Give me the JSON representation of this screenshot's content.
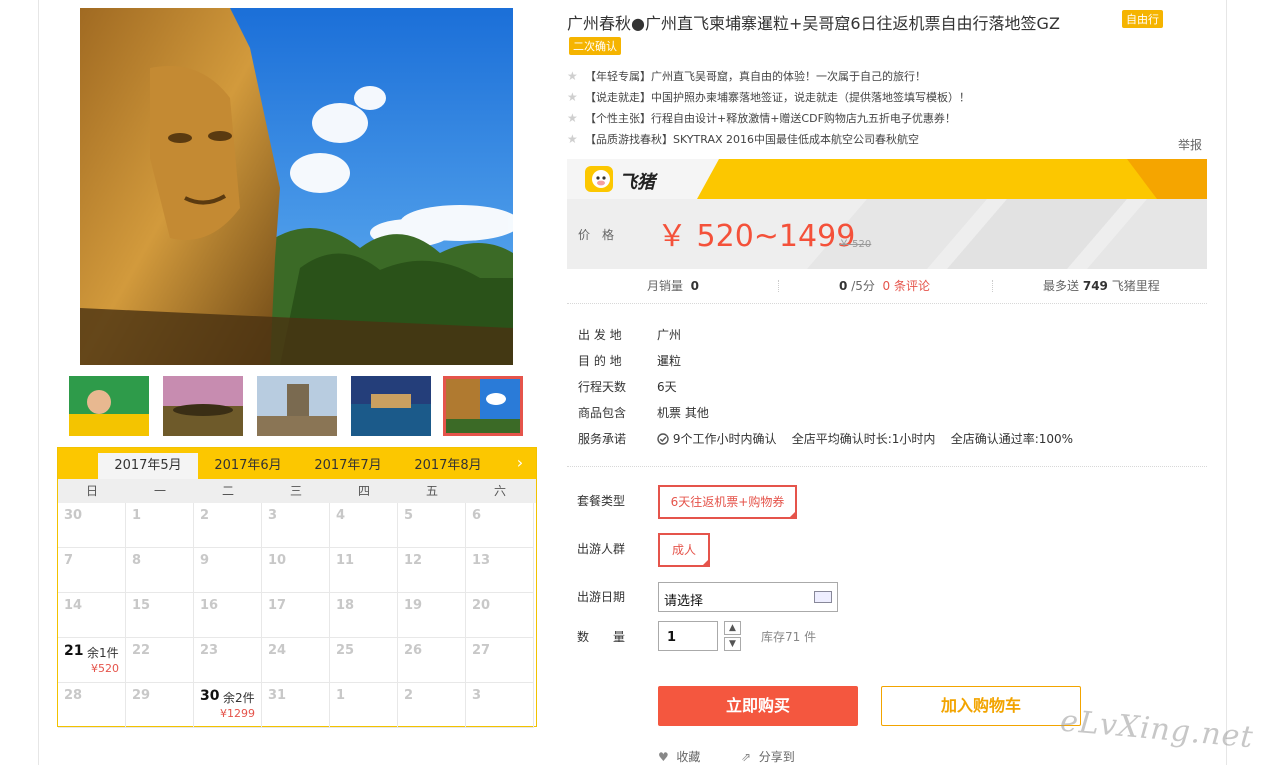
{
  "product": {
    "title": "广州春秋●广州直飞柬埔寨暹粒+吴哥窟6日往返机票自由行落地签GZ",
    "tag_free": "自由行",
    "tag_confirm": "二次确认",
    "features": [
      "【年轻专属】广州直飞吴哥窟，真自由的体验！一次属于自己的旅行！",
      "【说走就走】中国护照办柬埔寨落地签证，说走就走（提供落地签填写模板）！",
      "【个性主张】行程自由设计+释放激情+赠送CDF购物店九五折电子优惠券！",
      "【品质游找春秋】SKYTRAX 2016中国最佳低成本航空公司春秋航空"
    ],
    "report": "举报"
  },
  "brand": {
    "logo_text": "飞猪",
    "accent": "#fcc700"
  },
  "price": {
    "label": "价格",
    "current": "￥ 520~1499",
    "original": "￥ 520",
    "color": "#f4513a"
  },
  "stats": {
    "monthly_sales_label": "月销量",
    "monthly_sales_value": "0",
    "rating_value": "0",
    "rating_suffix": "/5分",
    "reviews_count": "0",
    "reviews_label": "条评论",
    "miles_prefix": "最多送",
    "miles_value": "749",
    "miles_suffix": "飞猪里程"
  },
  "info": {
    "departure_label": "出 发 地",
    "departure": "广州",
    "destination_label": "目 的 地",
    "destination": "暹粒",
    "days_label": "行程天数",
    "days": "6天",
    "includes_label": "商品包含",
    "includes": "机票  其他",
    "service_label": "服务承诺",
    "service_items": [
      "9个工作小时内确认",
      "全店平均确认时长:1小时内",
      "全店确认通过率:100%"
    ]
  },
  "options": {
    "package_label": "套餐类型",
    "package_value": "6天往返机票+购物券",
    "crowd_label": "出游人群",
    "crowd_value": "成人",
    "date_label": "出游日期",
    "date_value": "请选择",
    "qty_label": "数　　量",
    "qty_value": "1",
    "stock_text": "库存71 件",
    "step_up": "▲",
    "step_down": "▼"
  },
  "actions": {
    "buy_label": "立即购买",
    "cart_label": "加入购物车",
    "favorite_label": "收藏",
    "share_label": "分享到"
  },
  "calendar": {
    "tabs": [
      "2017年5月",
      "2017年6月",
      "2017年7月",
      "2017年8月"
    ],
    "next_icon": "›",
    "weekdays": [
      "日",
      "一",
      "二",
      "三",
      "四",
      "五",
      "六"
    ],
    "rows": [
      [
        {
          "d": "30"
        },
        {
          "d": "1"
        },
        {
          "d": "2"
        },
        {
          "d": "3"
        },
        {
          "d": "4"
        },
        {
          "d": "5"
        },
        {
          "d": "6"
        }
      ],
      [
        {
          "d": "7"
        },
        {
          "d": "8"
        },
        {
          "d": "9"
        },
        {
          "d": "10"
        },
        {
          "d": "11"
        },
        {
          "d": "12"
        },
        {
          "d": "13"
        }
      ],
      [
        {
          "d": "14"
        },
        {
          "d": "15"
        },
        {
          "d": "16"
        },
        {
          "d": "17"
        },
        {
          "d": "18"
        },
        {
          "d": "19"
        },
        {
          "d": "20"
        }
      ],
      [
        {
          "d": "21",
          "left": "余1件",
          "price": "¥520"
        },
        {
          "d": "22"
        },
        {
          "d": "23"
        },
        {
          "d": "24"
        },
        {
          "d": "25"
        },
        {
          "d": "26"
        },
        {
          "d": "27"
        }
      ],
      [
        {
          "d": "28"
        },
        {
          "d": "29"
        },
        {
          "d": "30",
          "left": "余2件",
          "price": "¥1299"
        },
        {
          "d": "31"
        },
        {
          "d": "1"
        },
        {
          "d": "2"
        },
        {
          "d": "3"
        }
      ]
    ]
  },
  "watermark": "eLvXing.net"
}
